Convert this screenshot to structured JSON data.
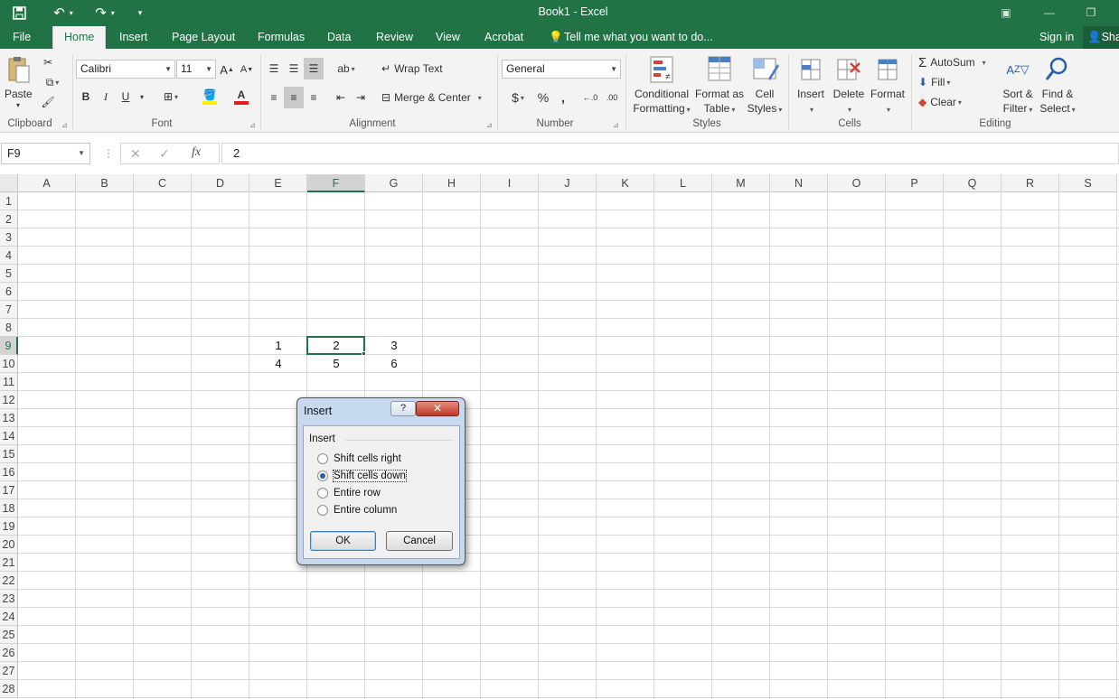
{
  "window": {
    "title": "Book1 - Excel"
  },
  "menu_tabs": [
    "File",
    "Home",
    "Insert",
    "Page Layout",
    "Formulas",
    "Data",
    "Review",
    "View",
    "Acrobat"
  ],
  "tell_me": "Tell me what you want to do...",
  "account": {
    "sign_in": "Sign in",
    "share": "Sha"
  },
  "ribbon": {
    "clipboard": {
      "paste": "Paste",
      "label": "Clipboard"
    },
    "font": {
      "name": "Calibri",
      "size": "11",
      "label": "Font",
      "bold": "B",
      "italic": "I",
      "underline": "U",
      "font_color": "#e02020",
      "highlight_color": "#ffef00"
    },
    "alignment": {
      "wrap_text": "Wrap Text",
      "merge_center": "Merge & Center",
      "label": "Alignment"
    },
    "number": {
      "format": "General",
      "currency": "$",
      "percent": "%",
      "comma": ",",
      "label": "Number"
    },
    "styles": {
      "conditional_1": "Conditional",
      "conditional_2": "Formatting",
      "format_table_1": "Format as",
      "format_table_2": "Table",
      "cell_styles_1": "Cell",
      "cell_styles_2": "Styles",
      "label": "Styles"
    },
    "cells": {
      "insert": "Insert",
      "delete": "Delete",
      "format": "Format",
      "label": "Cells"
    },
    "editing": {
      "autosum": "AutoSum",
      "fill": "Fill",
      "clear": "Clear",
      "sort_1": "Sort &",
      "sort_2": "Filter",
      "find_1": "Find &",
      "find_2": "Select",
      "label": "Editing"
    }
  },
  "formula_bar": {
    "name_box": "F9",
    "fx": "fx",
    "value": "2"
  },
  "columns": [
    "A",
    "B",
    "C",
    "D",
    "E",
    "F",
    "G",
    "H",
    "I",
    "J",
    "K",
    "L",
    "M",
    "N",
    "O",
    "P",
    "Q",
    "R",
    "S"
  ],
  "rows": [
    "1",
    "2",
    "3",
    "4",
    "5",
    "6",
    "7",
    "8",
    "9",
    "10",
    "11",
    "12",
    "13",
    "14",
    "15",
    "16",
    "17",
    "18",
    "19",
    "20",
    "21",
    "22",
    "23",
    "24",
    "25",
    "26",
    "27",
    "28"
  ],
  "cells": [
    {
      "ref": "E9",
      "value": "1"
    },
    {
      "ref": "F9",
      "value": "2"
    },
    {
      "ref": "G9",
      "value": "3"
    },
    {
      "ref": "E10",
      "value": "4"
    },
    {
      "ref": "F10",
      "value": "5"
    },
    {
      "ref": "G10",
      "value": "6"
    }
  ],
  "selection": {
    "cell": "F9",
    "column": "F",
    "row": "9"
  },
  "dialog": {
    "title": "Insert",
    "help": "?",
    "close": "✕",
    "group_label": "Insert",
    "options": [
      {
        "label": "Shift cells right",
        "selected": false
      },
      {
        "label": "Shift cells down",
        "selected": true
      },
      {
        "label": "Entire row",
        "selected": false
      },
      {
        "label": "Entire column",
        "selected": false
      }
    ],
    "ok": "OK",
    "cancel": "Cancel"
  }
}
